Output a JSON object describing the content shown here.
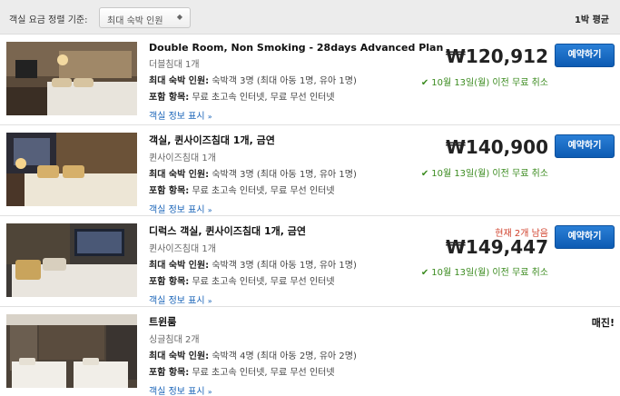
{
  "sort_bar": {
    "label": "객실 요금 정렬 기준:",
    "selected": "최대 숙박 인원",
    "caret": "◆",
    "per_night": "1박 평균"
  },
  "rooms": [
    {
      "name": "Double Room, Non Smoking - 28days Advanced Plan",
      "bed": "더블침대 1개",
      "occupancy_label": "최대 숙박 인원:",
      "occupancy": "숙박객 3명 (최대 아동 1명, 유아 1명)",
      "includes_label": "포함 항목:",
      "includes": "무료 초고속 인터넷, 무료 무선 인터넷",
      "more": "객실 정보 표시",
      "price": "₩120,912",
      "cancel": "10월 13일(월) 이전 무료 취소",
      "book": "예약하기"
    },
    {
      "name": "객실, 퀸사이즈침대 1개, 금연",
      "bed": "퀸사이즈침대 1개",
      "occupancy_label": "최대 숙박 인원:",
      "occupancy": "숙박객 3명 (최대 아동 1명, 유아 1명)",
      "includes_label": "포함 항목:",
      "includes": "무료 초고속 인터넷, 무료 무선 인터넷",
      "more": "객실 정보 표시",
      "price": "₩140,900",
      "cancel": "10월 13일(월) 이전 무료 취소",
      "book": "예약하기"
    },
    {
      "name": "디럭스 객실, 퀸사이즈침대 1개, 금연",
      "bed": "퀸사이즈침대 1개",
      "occupancy_label": "최대 숙박 인원:",
      "occupancy": "숙박객 3명 (최대 아동 1명, 유아 1명)",
      "includes_label": "포함 항목:",
      "includes": "무료 초고속 인터넷, 무료 무선 인터넷",
      "more": "객실 정보 표시",
      "urgent": "현재 2개 남음",
      "price": "₩149,447",
      "cancel": "10월 13일(월) 이전 무료 취소",
      "book": "예약하기"
    },
    {
      "name": "트윈룸",
      "bed": "싱글침대 2개",
      "occupancy_label": "최대 숙박 인원:",
      "occupancy": "숙박객 4명 (최대 아동 2명, 유아 2명)",
      "includes_label": "포함 항목:",
      "includes": "무료 초고속 인터넷, 무료 무선 인터넷",
      "more": "객실 정보 표시",
      "status": "매진!"
    }
  ],
  "icons": {
    "check": "✔",
    "chevron": "»"
  },
  "colors": {
    "button": "#0d5bb3",
    "link": "#1a64b8",
    "cancel_green": "#3b8b1f",
    "urgent_red": "#d0402b"
  }
}
